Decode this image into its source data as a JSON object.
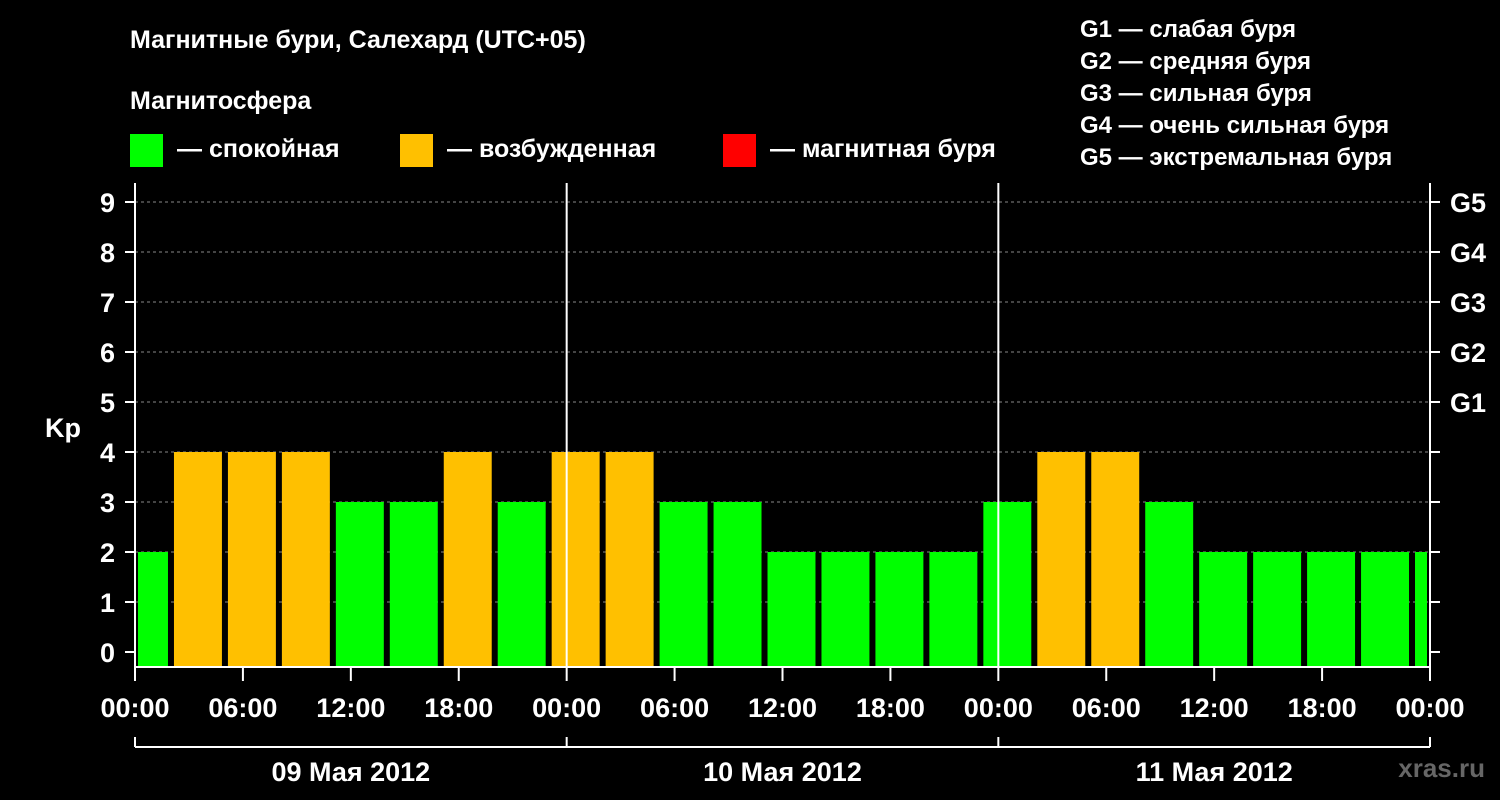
{
  "chart_data": {
    "type": "bar",
    "title": "Магнитные бури, Салехард (UTC+05)",
    "legend_title": "Магнитосфера",
    "legend": [
      {
        "label": "— спокойная",
        "color": "#00ff00"
      },
      {
        "label": "— возбужденная",
        "color": "#ffc000"
      },
      {
        "label": "— магнитная буря",
        "color": "#ff0000"
      }
    ],
    "g_scale": [
      "G1 — слабая буря",
      "G2 — средняя буря",
      "G3 — сильная буря",
      "G4 — очень сильная буря",
      "G5 — экстремальная буря"
    ],
    "ylabel": "Kp",
    "ylim": [
      0,
      9
    ],
    "y_ticks": [
      "0",
      "1",
      "2",
      "3",
      "4",
      "5",
      "6",
      "7",
      "8",
      "9"
    ],
    "right_ticks": [
      {
        "value": 5,
        "label": "G1"
      },
      {
        "value": 6,
        "label": "G2"
      },
      {
        "value": 7,
        "label": "G3"
      },
      {
        "value": 8,
        "label": "G4"
      },
      {
        "value": 9,
        "label": "G5"
      }
    ],
    "x_tick_labels": [
      "00:00",
      "06:00",
      "12:00",
      "18:00",
      "00:00",
      "06:00",
      "12:00",
      "18:00",
      "00:00",
      "06:00",
      "12:00",
      "18:00",
      "00:00"
    ],
    "days": [
      "09 Мая 2012",
      "10 Мая 2012",
      "11 Мая 2012"
    ],
    "x_range_hours": [
      0,
      72
    ],
    "bars": [
      {
        "start": 0,
        "end": 2,
        "kp": 2,
        "status": "quiet"
      },
      {
        "start": 2,
        "end": 5,
        "kp": 4,
        "status": "active"
      },
      {
        "start": 5,
        "end": 8,
        "kp": 4,
        "status": "active"
      },
      {
        "start": 8,
        "end": 11,
        "kp": 4,
        "status": "active"
      },
      {
        "start": 11,
        "end": 14,
        "kp": 3,
        "status": "quiet"
      },
      {
        "start": 14,
        "end": 17,
        "kp": 3,
        "status": "quiet"
      },
      {
        "start": 17,
        "end": 20,
        "kp": 4,
        "status": "active"
      },
      {
        "start": 20,
        "end": 23,
        "kp": 3,
        "status": "quiet"
      },
      {
        "start": 23,
        "end": 26,
        "kp": 4,
        "status": "active"
      },
      {
        "start": 26,
        "end": 29,
        "kp": 4,
        "status": "active"
      },
      {
        "start": 29,
        "end": 32,
        "kp": 3,
        "status": "quiet"
      },
      {
        "start": 32,
        "end": 35,
        "kp": 3,
        "status": "quiet"
      },
      {
        "start": 35,
        "end": 38,
        "kp": 2,
        "status": "quiet"
      },
      {
        "start": 38,
        "end": 41,
        "kp": 2,
        "status": "quiet"
      },
      {
        "start": 41,
        "end": 44,
        "kp": 2,
        "status": "quiet"
      },
      {
        "start": 44,
        "end": 47,
        "kp": 2,
        "status": "quiet"
      },
      {
        "start": 47,
        "end": 50,
        "kp": 3,
        "status": "quiet"
      },
      {
        "start": 50,
        "end": 53,
        "kp": 4,
        "status": "active"
      },
      {
        "start": 53,
        "end": 56,
        "kp": 4,
        "status": "active"
      },
      {
        "start": 56,
        "end": 59,
        "kp": 3,
        "status": "quiet"
      },
      {
        "start": 59,
        "end": 62,
        "kp": 2,
        "status": "quiet"
      },
      {
        "start": 62,
        "end": 65,
        "kp": 2,
        "status": "quiet"
      },
      {
        "start": 65,
        "end": 68,
        "kp": 2,
        "status": "quiet"
      },
      {
        "start": 68,
        "end": 71,
        "kp": 2,
        "status": "quiet"
      },
      {
        "start": 71,
        "end": 72,
        "kp": 2,
        "status": "quiet"
      }
    ],
    "status_colors": {
      "quiet": "#00ff00",
      "active": "#ffc000",
      "storm": "#ff0000"
    },
    "grid": "dashed horizontal",
    "watermark": "xras.ru"
  }
}
